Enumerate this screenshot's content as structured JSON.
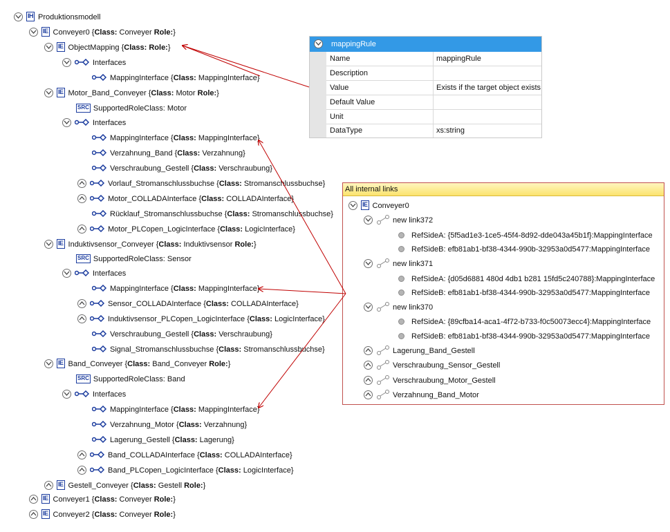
{
  "tree": {
    "root": "Produktionsmodell",
    "conveyer0": {
      "name": "Conveyer0",
      "class": "Conveyer"
    },
    "object_mapping": {
      "name": "ObjectMapping",
      "class": ""
    },
    "om_interfaces": "Interfaces",
    "om_mapping": {
      "name": "MappingInterface",
      "class": "MappingInterface"
    },
    "motor_band": {
      "name": "Motor_Band_Conveyer",
      "class": "Motor"
    },
    "motor_src": "SupportedRoleClass: Motor",
    "motor_interfaces": "Interfaces",
    "motor_if": [
      {
        "name": "MappingInterface",
        "class": "MappingInterface"
      },
      {
        "name": "Verzahnung_Band",
        "class": "Verzahnung"
      },
      {
        "name": "Verschraubung_Gestell",
        "class": "Verschraubung"
      },
      {
        "name": "Vorlauf_Stromanschlussbuchse",
        "class": "Stromanschlussbuchse"
      },
      {
        "name": "Motor_COLLADAInterface",
        "class": "COLLADAInterface"
      },
      {
        "name": "Rücklauf_Stromanschlussbuchse",
        "class": "Stromanschlussbuchse"
      },
      {
        "name": "Motor_PLCopen_LogicInterface",
        "class": "LogicInterface"
      }
    ],
    "sensor": {
      "name": "Induktivsensor_Conveyer",
      "class": "Induktivsensor"
    },
    "sensor_src": "SupportedRoleClass: Sensor",
    "sensor_interfaces": "Interfaces",
    "sensor_if": [
      {
        "name": "MappingInterface",
        "class": "MappingInterface"
      },
      {
        "name": "Sensor_COLLADAInterface",
        "class": "COLLADAInterface"
      },
      {
        "name": "Induktivsensor_PLCopen_LogicInterface",
        "class": "LogicInterface"
      },
      {
        "name": "Verschraubung_Gestell",
        "class": "Verschraubung"
      },
      {
        "name": "Signal_Stromanschlussbuchse",
        "class": "Stromanschlussbuchse"
      }
    ],
    "band": {
      "name": "Band_Conveyer",
      "class": "Band_Conveyer"
    },
    "band_src": "SupportedRoleClass: Band",
    "band_interfaces": "Interfaces",
    "band_if": [
      {
        "name": "MappingInterface",
        "class": "MappingInterface"
      },
      {
        "name": "Verzahnung_Motor",
        "class": "Verzahnung"
      },
      {
        "name": "Lagerung_Gestell",
        "class": "Lagerung"
      },
      {
        "name": "Band_COLLADAInterface",
        "class": "COLLADAInterface"
      },
      {
        "name": "Band_PLCopen_LogicInterface",
        "class": "LogicInterface"
      }
    ],
    "gestell": {
      "name": "Gestell_Conveyer",
      "class": "Gestell"
    },
    "conveyer1": {
      "name": "Conveyer1",
      "class": "Conveyer"
    },
    "conveyer2": {
      "name": "Conveyer2",
      "class": "Conveyer"
    },
    "class_label": "Class:",
    "role_label": "Role:"
  },
  "properties": {
    "header": "mappingRule",
    "rows": [
      {
        "key": "Name",
        "value": "mappingRule"
      },
      {
        "key": "Description",
        "value": ""
      },
      {
        "key": "Value",
        "value": "Exists if the target object exists"
      },
      {
        "key": "Default Value",
        "value": ""
      },
      {
        "key": "Unit",
        "value": ""
      },
      {
        "key": "DataType",
        "value": "xs:string"
      }
    ]
  },
  "links": {
    "header": "All internal links",
    "root": "Conveyer0",
    "link372": {
      "name": "new link372",
      "a": "RefSideA: {5f5ad1e3-1ce5-45f4-8d92-dde043a45b1f}:MappingInterface",
      "b": "RefSideB: efb81ab1-bf38-4344-990b-32953a0d5477:MappingInterface"
    },
    "link371": {
      "name": "new link371",
      "a": "RefSideA: {d05d6881 480d 4db1 b281 15fd5c240788}:MappingInterface",
      "b": "RefSideB: efb81ab1-bf38-4344-990b-32953a0d5477:MappingInterface"
    },
    "link370": {
      "name": "new link370",
      "a": "RefSideA: {89cfba14-aca1-4f72-b733-f0c50073ecc4}:MappingInterface",
      "b": "RefSideB: efb81ab1-bf38-4344-990b-32953a0d5477:MappingInterface"
    },
    "others": [
      "Lagerung_Band_Gestell",
      "Verschraubung_Sensor_Gestell",
      "Verschraubung_Motor_Gestell",
      "Verzahnung_Band_Motor"
    ]
  },
  "colors": {
    "accent": "#1a3b9e",
    "header_blue": "#3399e6",
    "arrow_red": "#c00000",
    "panel_border": "#c0504d"
  }
}
